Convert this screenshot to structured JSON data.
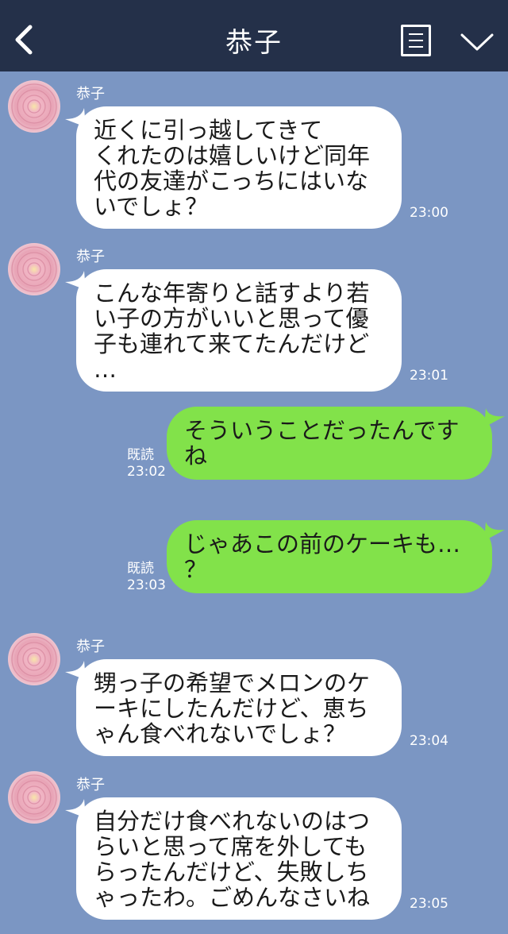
{
  "header": {
    "title": "恭子",
    "back_icon": "chevron-left-icon",
    "menu_icon": "list-icon",
    "collapse_icon": "chevron-down-icon",
    "bg_color": "#243049"
  },
  "chat": {
    "bg_color": "#7b96c3",
    "incoming_color": "#ffffff",
    "outgoing_color": "#82e24a",
    "messages": [
      {
        "direction": "in",
        "sender": "恭子",
        "lines": [
          "近くに引っ越してきて",
          "くれたのは嬉しいけど同年",
          "代の友達がこっちにはいな",
          "いでしょ？"
        ],
        "time": "23:00"
      },
      {
        "direction": "in",
        "sender": "恭子",
        "lines": [
          "こんな年寄りと話すより若",
          "い子の方がいいと思って優",
          "子も連れて来てたんだけど",
          "…"
        ],
        "time": "23:01"
      },
      {
        "direction": "out",
        "lines": [
          "そういうことだったんです",
          "ね"
        ],
        "read": "既読",
        "time": "23:02"
      },
      {
        "direction": "out",
        "lines": [
          "じゃあこの前のケーキも…",
          "？"
        ],
        "read": "既読",
        "time": "23:03"
      },
      {
        "direction": "in",
        "sender": "恭子",
        "lines": [
          "甥っ子の希望でメロンのケ",
          "ーキにしたんだけど、恵ち",
          "ゃん食べれないでしょ？"
        ],
        "time": "23:04"
      },
      {
        "direction": "in",
        "sender": "恭子",
        "lines": [
          "自分だけ食べれないのはつ",
          "らいと思って席を外しても",
          "らったんだけど、失敗しち",
          "ゃったわ。ごめんなさいね"
        ],
        "time": "23:05"
      }
    ]
  }
}
